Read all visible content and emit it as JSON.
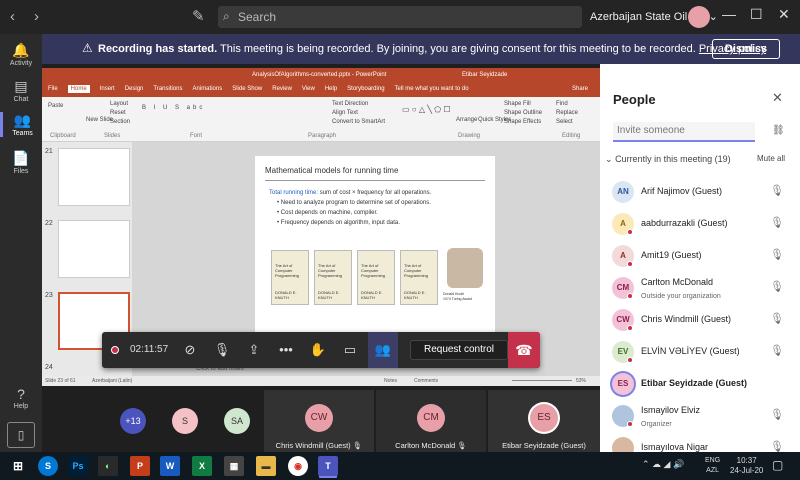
{
  "titlebar": {
    "back": "‹",
    "forward": "›",
    "search_placeholder": "Search",
    "org": "Azerbaijan State Oil a...",
    "org_caret": "⌄",
    "minimize": "—",
    "maximize": "☐",
    "close": "✕"
  },
  "rail": [
    {
      "label": "Activity",
      "icon": "🔔"
    },
    {
      "label": "Chat",
      "icon": "▤"
    },
    {
      "label": "Teams",
      "icon": "👥"
    },
    {
      "label": "Files",
      "icon": "📄"
    },
    {
      "label": "Help",
      "icon": "?"
    }
  ],
  "banner": {
    "bold": "Recording has started.",
    "text": " This meeting is being recorded. By joining, you are giving consent for this meeting to be recorded. ",
    "link": "Privacy policy",
    "dismiss": "Dismiss"
  },
  "ppt": {
    "title": "AnalysisOfAlgorithms-converted.pptx - PowerPoint",
    "user": "Etibar Seyidzade",
    "menu": [
      "File",
      "Home",
      "Insert",
      "Design",
      "Transitions",
      "Animations",
      "Slide Show",
      "Review",
      "View",
      "Help",
      "Storyboarding",
      "Tell me what you want to do",
      "Share"
    ],
    "ribbon_groups": [
      "Clipboard",
      "Slides",
      "Font",
      "Paragraph",
      "Drawing",
      "Editing"
    ],
    "ribbon_items": [
      "Paste",
      "New Slide",
      "Layout",
      "Reset",
      "Section",
      "Text Direction",
      "Align Text",
      "Convert to SmartArt",
      "Arrange",
      "Quick Styles",
      "Shape Fill",
      "Shape Outline",
      "Shape Effects",
      "Find",
      "Replace",
      "Select"
    ],
    "thumb_numbers": [
      "21",
      "22",
      "23",
      "24"
    ],
    "slide_title": "Mathematical models for running time",
    "slide_lead_key": "Total running time:",
    "slide_lead": " sum of cost × frequency for all operations.",
    "slide_bullets": [
      "Need to analyze program to determine set of operations.",
      "Cost depends on machine, compiler.",
      "Frequency depends on algorithm, input data."
    ],
    "book_title": "The Art of Computer Programming",
    "book_author": "DONALD E. KNUTH",
    "photo_caption": [
      "Donald Knuth",
      "1974 Turing Award"
    ],
    "status_left": "Slide 23 of 61",
    "status_lang": "Azerbaijani (Latin)",
    "notes_hint": "Click to add notes",
    "status_notes": "Notes",
    "status_comments": "Comments",
    "zoom": "53%"
  },
  "callbar": {
    "timer": "02:11:57",
    "request_control": "Request control"
  },
  "strip": {
    "overflow": "+13",
    "small_avatars": [
      {
        "initials": "S",
        "color": "#f4c2c6"
      },
      {
        "initials": "SA",
        "color": "#cfe6cf"
      }
    ],
    "tiles": [
      {
        "initials": "CW",
        "name": "Chris Windmill (Guest)"
      },
      {
        "initials": "CM",
        "name": "Carlton McDonald"
      },
      {
        "initials": "ES",
        "name": "Etibar Seyidzade (Guest)"
      }
    ]
  },
  "people": {
    "heading": "People",
    "invite_placeholder": "Invite someone",
    "current": "Currently in this meeting (19)",
    "mute_all": "Mute all",
    "rows": [
      {
        "initials": "AN",
        "name": "Arif Najimov (Guest)",
        "sub": "",
        "bg": "#dbe6f4",
        "fg": "#2b579a",
        "dot": false
      },
      {
        "initials": "A",
        "name": "aabdurrazakli (Guest)",
        "sub": "",
        "bg": "#fbe9b7",
        "fg": "#8a6a00",
        "dot": true
      },
      {
        "initials": "A",
        "name": "Amit19 (Guest)",
        "sub": "",
        "bg": "#f4d9d9",
        "fg": "#8a2b2b",
        "dot": true
      },
      {
        "initials": "CM",
        "name": "Carlton McDonald",
        "sub": "Outside your organization",
        "bg": "#f4c2d6",
        "fg": "#8a1f4b",
        "dot": true
      },
      {
        "initials": "CW",
        "name": "Chris Windmill (Guest)",
        "sub": "",
        "bg": "#f4c2d6",
        "fg": "#8a1f4b",
        "dot": true
      },
      {
        "initials": "EV",
        "name": "ELVİN VƏLİYEV (Guest)",
        "sub": "",
        "bg": "#dcebd0",
        "fg": "#3b6e1e",
        "dot": true
      },
      {
        "initials": "ES",
        "name": "Etibar Seyidzade (Guest)",
        "sub": "",
        "bg": "#f4c2d6",
        "fg": "#8a1f4b",
        "dot": false
      },
      {
        "initials": "",
        "name": "Ismayilov Elviz",
        "sub": "Organizer",
        "bg": "#b0c4de",
        "fg": "#333",
        "dot": true
      },
      {
        "initials": "",
        "name": "Ismayılova Nigar",
        "sub": "",
        "bg": "#d8b8a0",
        "fg": "#333",
        "dot": true
      }
    ]
  },
  "taskbar": {
    "apps": [
      "S",
      "Ps",
      "◐",
      "P",
      "W",
      "X",
      "▦",
      "▬",
      "◉",
      "T"
    ],
    "lang": [
      "ENG",
      "AZL"
    ],
    "time": "10:37",
    "date": "24-Jul-20"
  }
}
